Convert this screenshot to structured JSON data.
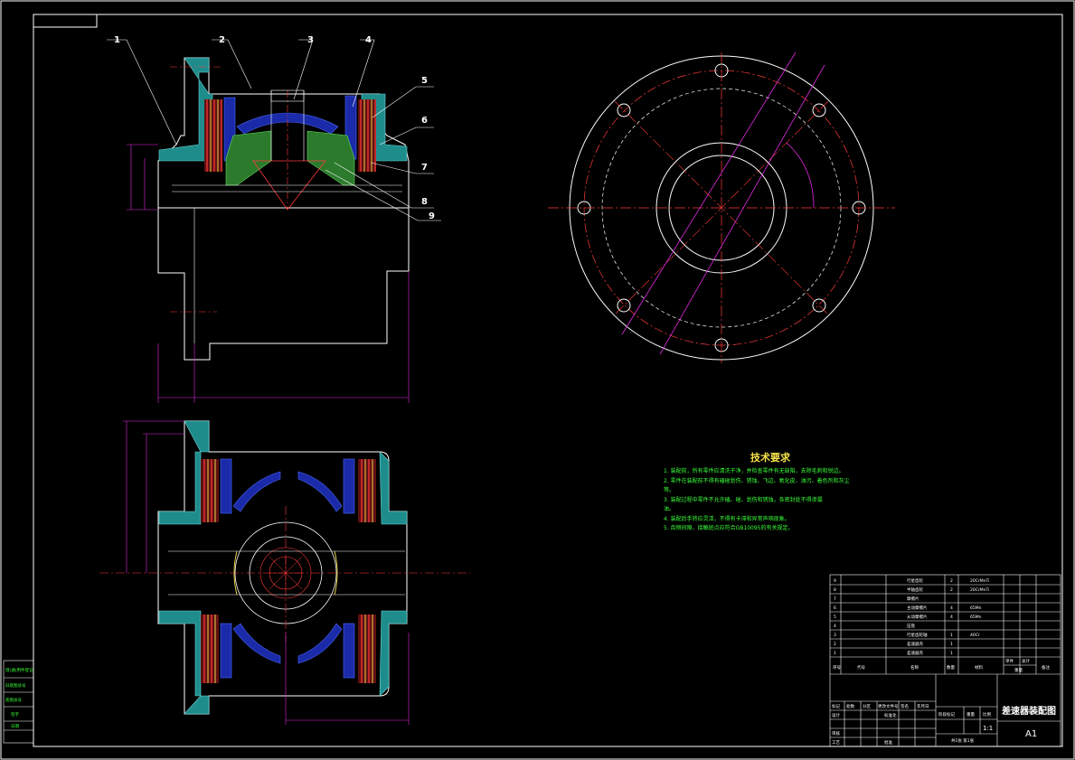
{
  "drawing": {
    "callouts": [
      "1",
      "2",
      "3",
      "4",
      "5",
      "6",
      "7",
      "8",
      "9"
    ],
    "technical_requirements": {
      "title": "技术要求",
      "lines": [
        "1. 装配前，所有零件应清洗干净，并检查零件有无缺陷，去除毛刺和锐边。",
        "2. 零件在装配前不得有磕碰划伤、锈蚀、飞边、氧化皮、油污、着色剂和灰尘",
        "等。",
        "3. 装配过程中零件不允许磕、碰、划伤和锈蚀，各密封处不得渗漏",
        "油。",
        "4. 装配后手转应灵活，不得有卡滞和异常声响现象。",
        "5. 齿侧间隙、接触斑点应符合GB10095的有关规定。"
      ]
    },
    "title_block": {
      "parts_rows": [
        {
          "no": "9",
          "name": "行星齿轮",
          "qty": "2",
          "material": "20CrMnTi"
        },
        {
          "no": "8",
          "name": "半轴齿轮",
          "qty": "2",
          "material": "20CrMnTi"
        },
        {
          "no": "7",
          "name": "摩擦片",
          "qty": "",
          "material": ""
        },
        {
          "no": "6",
          "name": "主动摩擦片",
          "qty": "4",
          "material": "65Mn"
        },
        {
          "no": "5",
          "name": "从动摩擦片",
          "qty": "4",
          "material": "65Mn"
        },
        {
          "no": "4",
          "name": "压盘",
          "qty": "",
          "material": ""
        },
        {
          "no": "3",
          "name": "行星齿轮轴",
          "qty": "1",
          "material": "40Cr"
        },
        {
          "no": "2",
          "name": "差速器壳",
          "qty": "1",
          "material": ""
        },
        {
          "no": "1",
          "name": "差速器壳",
          "qty": "1",
          "material": ""
        }
      ],
      "header": {
        "no": "序号",
        "code": "代号",
        "name": "名称",
        "qty": "数量",
        "material": "材料",
        "unit_weight": "单件",
        "total_weight": "总计",
        "weight": "重量",
        "remarks": "备注"
      },
      "drawing_title": "差速器装配图",
      "sheet_size": "A1",
      "scale": "1:1",
      "scale_label": "比例",
      "weight_label": "重量",
      "stage_label": "阶段标记",
      "sheets_label": "共1张 第1张",
      "designer_label": "设计",
      "checker_label": "审核",
      "process_label": "工艺",
      "approve_label": "批准",
      "standardize_label": "标准化",
      "mark_labels": [
        "标记",
        "处数",
        "分区",
        "更改文件号",
        "签名",
        "年月日"
      ]
    },
    "side_block": [
      "借(通)用件登记",
      "旧底图总号",
      "底图总号",
      "签字",
      "日期"
    ]
  }
}
